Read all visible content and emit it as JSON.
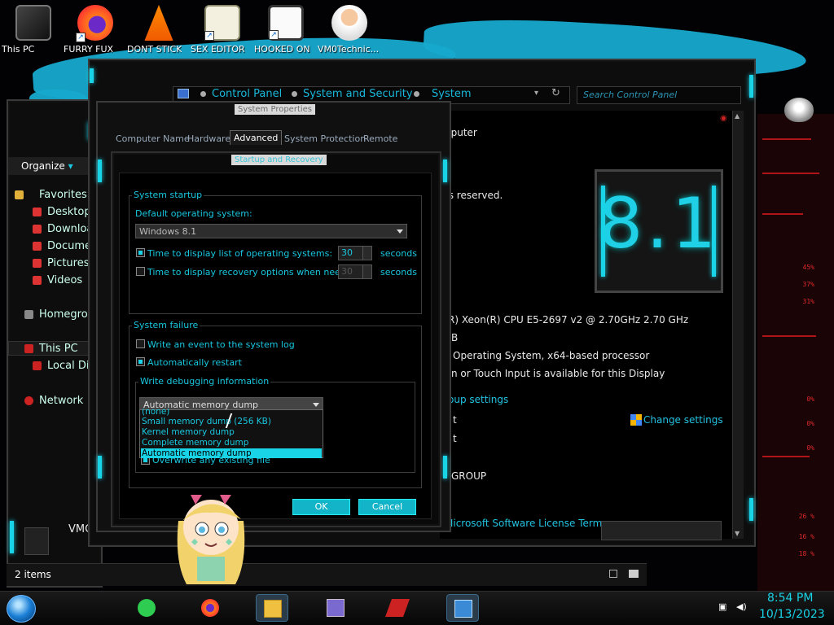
{
  "desktop": {
    "icons": [
      {
        "label": "This PC"
      },
      {
        "label": "FURRY FUX"
      },
      {
        "label": "DONT STICK"
      },
      {
        "label": "SEX EDITOR"
      },
      {
        "label": "HOOKED ON"
      },
      {
        "label": "VM0Technic..."
      }
    ]
  },
  "explorer": {
    "organize": "Organize",
    "nav": {
      "favorites": "Favorites",
      "desktop": "Desktop",
      "downloads": "Downloa",
      "documents": "Documen",
      "pictures": "Pictures",
      "videos": "Videos",
      "homegroup": "Homegroup",
      "this_pc": "This PC",
      "local_disk": "Local Dis",
      "network": "Network"
    },
    "status": "2 items",
    "bottom_item": "VMC"
  },
  "control_panel": {
    "breadcrumb": [
      "Control Panel",
      "System and Security",
      "System"
    ],
    "search_placeholder": "Search Control Panel",
    "text": {
      "computer": "nputer",
      "rights": "ts reserved.",
      "cpu": "R) Xeon(R) CPU E5-2697 v2 @ 2.70GHz   2.70 GHz",
      "ram": "B",
      "os_type": "Operating System, x64-based processor",
      "pen": "n or Touch Input is available for this Display",
      "group_settings": "oup settings",
      "line_t1": "t",
      "line_t2": "t",
      "workgroup": "GROUP",
      "license": "Microsoft Software License Terms"
    },
    "change_settings": "Change settings",
    "badge": "8.1"
  },
  "system_properties": {
    "title": "System Properties",
    "tabs": [
      "Computer Name",
      "Hardware",
      "Advanced",
      "System Protection",
      "Remote"
    ],
    "active_tab": "Advanced"
  },
  "startup_recovery": {
    "title": "Startup and Recovery",
    "system_startup": {
      "group_title": "System startup",
      "default_os_label": "Default operating system:",
      "default_os_value": "Windows 8.1",
      "display_list_label": "Time to display list of operating systems:",
      "display_list_value": "30",
      "display_list_checked": true,
      "recovery_label": "Time to display recovery options when needed:",
      "recovery_value": "30",
      "recovery_checked": false,
      "seconds": "seconds"
    },
    "system_failure": {
      "group_title": "System failure",
      "write_event_label": "Write an event to the system log",
      "write_event_checked": false,
      "auto_restart_label": "Automatically restart",
      "auto_restart_checked": true,
      "debug_group_title": "Write debugging information",
      "debug_value": "Automatic memory dump",
      "debug_options": [
        "(none)",
        "Small memory dump (256 KB)",
        "Kernel memory dump",
        "Complete memory dump",
        "Automatic memory dump"
      ],
      "overwrite_label": "Overwrite any existing file",
      "overwrite_checked": true
    },
    "ok": "OK",
    "cancel": "Cancel"
  },
  "wallpaper": {
    "meter_labels": [
      "45%",
      "37%",
      "31%",
      "0%",
      "0%",
      "0%",
      "26 %",
      "16 %",
      "18 %"
    ]
  },
  "taskbar": {
    "time": "8:54 PM",
    "date": "10/13/2023"
  },
  "colors": {
    "accent": "#19d3e6",
    "link": "#22c2e0",
    "wallpaper_red": "#b01419"
  }
}
